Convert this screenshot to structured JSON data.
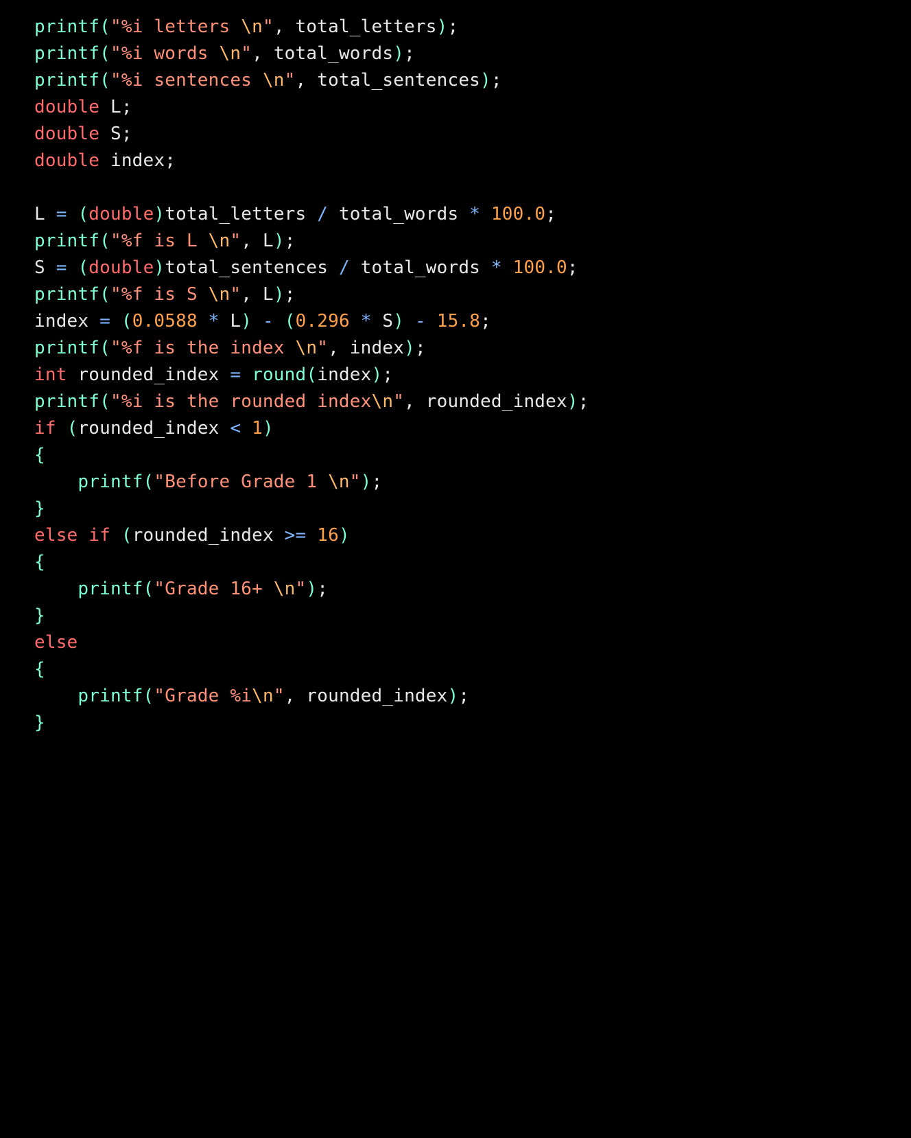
{
  "code": {
    "lines": [
      [
        {
          "cls": "tok-fn",
          "t": "printf"
        },
        {
          "cls": "tok-brace",
          "t": "("
        },
        {
          "cls": "tok-str",
          "t": "\"%i letters "
        },
        {
          "cls": "tok-esc",
          "t": "\\n"
        },
        {
          "cls": "tok-str",
          "t": "\""
        },
        {
          "cls": "tok-punc",
          "t": ", "
        },
        {
          "cls": "tok-var",
          "t": "total_letters"
        },
        {
          "cls": "tok-brace",
          "t": ")"
        },
        {
          "cls": "tok-punc",
          "t": ";"
        }
      ],
      [
        {
          "cls": "tok-fn",
          "t": "printf"
        },
        {
          "cls": "tok-brace",
          "t": "("
        },
        {
          "cls": "tok-str",
          "t": "\"%i words "
        },
        {
          "cls": "tok-esc",
          "t": "\\n"
        },
        {
          "cls": "tok-str",
          "t": "\""
        },
        {
          "cls": "tok-punc",
          "t": ", "
        },
        {
          "cls": "tok-var",
          "t": "total_words"
        },
        {
          "cls": "tok-brace",
          "t": ")"
        },
        {
          "cls": "tok-punc",
          "t": ";"
        }
      ],
      [
        {
          "cls": "tok-fn",
          "t": "printf"
        },
        {
          "cls": "tok-brace",
          "t": "("
        },
        {
          "cls": "tok-str",
          "t": "\"%i sentences "
        },
        {
          "cls": "tok-esc",
          "t": "\\n"
        },
        {
          "cls": "tok-str",
          "t": "\""
        },
        {
          "cls": "tok-punc",
          "t": ", "
        },
        {
          "cls": "tok-var",
          "t": "total_sentences"
        },
        {
          "cls": "tok-brace",
          "t": ")"
        },
        {
          "cls": "tok-punc",
          "t": ";"
        }
      ],
      [
        {
          "cls": "tok-kw",
          "t": "double"
        },
        {
          "cls": "tok-var",
          "t": " L"
        },
        {
          "cls": "tok-punc",
          "t": ";"
        }
      ],
      [
        {
          "cls": "tok-kw",
          "t": "double"
        },
        {
          "cls": "tok-var",
          "t": " S"
        },
        {
          "cls": "tok-punc",
          "t": ";"
        }
      ],
      [
        {
          "cls": "tok-kw",
          "t": "double"
        },
        {
          "cls": "tok-var",
          "t": " index"
        },
        {
          "cls": "tok-punc",
          "t": ";"
        }
      ],
      [
        {
          "cls": "tok-var",
          "t": ""
        }
      ],
      [
        {
          "cls": "tok-var",
          "t": "L "
        },
        {
          "cls": "tok-op",
          "t": "="
        },
        {
          "cls": "tok-var",
          "t": " "
        },
        {
          "cls": "tok-brace",
          "t": "("
        },
        {
          "cls": "tok-kw",
          "t": "double"
        },
        {
          "cls": "tok-brace",
          "t": ")"
        },
        {
          "cls": "tok-var",
          "t": "total_letters "
        },
        {
          "cls": "tok-op",
          "t": "/"
        },
        {
          "cls": "tok-var",
          "t": " total_words "
        },
        {
          "cls": "tok-op",
          "t": "*"
        },
        {
          "cls": "tok-var",
          "t": " "
        },
        {
          "cls": "tok-num",
          "t": "100.0"
        },
        {
          "cls": "tok-punc",
          "t": ";"
        }
      ],
      [
        {
          "cls": "tok-fn",
          "t": "printf"
        },
        {
          "cls": "tok-brace",
          "t": "("
        },
        {
          "cls": "tok-str",
          "t": "\"%f is L "
        },
        {
          "cls": "tok-esc",
          "t": "\\n"
        },
        {
          "cls": "tok-str",
          "t": "\""
        },
        {
          "cls": "tok-punc",
          "t": ", "
        },
        {
          "cls": "tok-var",
          "t": "L"
        },
        {
          "cls": "tok-brace",
          "t": ")"
        },
        {
          "cls": "tok-punc",
          "t": ";"
        }
      ],
      [
        {
          "cls": "tok-var",
          "t": "S "
        },
        {
          "cls": "tok-op",
          "t": "="
        },
        {
          "cls": "tok-var",
          "t": " "
        },
        {
          "cls": "tok-brace",
          "t": "("
        },
        {
          "cls": "tok-kw",
          "t": "double"
        },
        {
          "cls": "tok-brace",
          "t": ")"
        },
        {
          "cls": "tok-var",
          "t": "total_sentences "
        },
        {
          "cls": "tok-op",
          "t": "/"
        },
        {
          "cls": "tok-var",
          "t": " total_words "
        },
        {
          "cls": "tok-op",
          "t": "*"
        },
        {
          "cls": "tok-var",
          "t": " "
        },
        {
          "cls": "tok-num",
          "t": "100.0"
        },
        {
          "cls": "tok-punc",
          "t": ";"
        }
      ],
      [
        {
          "cls": "tok-fn",
          "t": "printf"
        },
        {
          "cls": "tok-brace",
          "t": "("
        },
        {
          "cls": "tok-str",
          "t": "\"%f is S "
        },
        {
          "cls": "tok-esc",
          "t": "\\n"
        },
        {
          "cls": "tok-str",
          "t": "\""
        },
        {
          "cls": "tok-punc",
          "t": ", "
        },
        {
          "cls": "tok-var",
          "t": "L"
        },
        {
          "cls": "tok-brace",
          "t": ")"
        },
        {
          "cls": "tok-punc",
          "t": ";"
        }
      ],
      [
        {
          "cls": "tok-var",
          "t": "index "
        },
        {
          "cls": "tok-op",
          "t": "="
        },
        {
          "cls": "tok-var",
          "t": " "
        },
        {
          "cls": "tok-brace",
          "t": "("
        },
        {
          "cls": "tok-num",
          "t": "0.0588"
        },
        {
          "cls": "tok-var",
          "t": " "
        },
        {
          "cls": "tok-op",
          "t": "*"
        },
        {
          "cls": "tok-var",
          "t": " L"
        },
        {
          "cls": "tok-brace",
          "t": ")"
        },
        {
          "cls": "tok-var",
          "t": " "
        },
        {
          "cls": "tok-op",
          "t": "-"
        },
        {
          "cls": "tok-var",
          "t": " "
        },
        {
          "cls": "tok-brace",
          "t": "("
        },
        {
          "cls": "tok-num",
          "t": "0.296"
        },
        {
          "cls": "tok-var",
          "t": " "
        },
        {
          "cls": "tok-op",
          "t": "*"
        },
        {
          "cls": "tok-var",
          "t": " S"
        },
        {
          "cls": "tok-brace",
          "t": ")"
        },
        {
          "cls": "tok-var",
          "t": " "
        },
        {
          "cls": "tok-op",
          "t": "-"
        },
        {
          "cls": "tok-var",
          "t": " "
        },
        {
          "cls": "tok-num",
          "t": "15.8"
        },
        {
          "cls": "tok-punc",
          "t": ";"
        }
      ],
      [
        {
          "cls": "tok-fn",
          "t": "printf"
        },
        {
          "cls": "tok-brace",
          "t": "("
        },
        {
          "cls": "tok-str",
          "t": "\"%f is the index "
        },
        {
          "cls": "tok-esc",
          "t": "\\n"
        },
        {
          "cls": "tok-str",
          "t": "\""
        },
        {
          "cls": "tok-punc",
          "t": ", "
        },
        {
          "cls": "tok-var",
          "t": "index"
        },
        {
          "cls": "tok-brace",
          "t": ")"
        },
        {
          "cls": "tok-punc",
          "t": ";"
        }
      ],
      [
        {
          "cls": "tok-kw",
          "t": "int"
        },
        {
          "cls": "tok-var",
          "t": " rounded_index "
        },
        {
          "cls": "tok-op",
          "t": "="
        },
        {
          "cls": "tok-var",
          "t": " "
        },
        {
          "cls": "tok-fn",
          "t": "round"
        },
        {
          "cls": "tok-brace",
          "t": "("
        },
        {
          "cls": "tok-var",
          "t": "index"
        },
        {
          "cls": "tok-brace",
          "t": ")"
        },
        {
          "cls": "tok-punc",
          "t": ";"
        }
      ],
      [
        {
          "cls": "tok-fn",
          "t": "printf"
        },
        {
          "cls": "tok-brace",
          "t": "("
        },
        {
          "cls": "tok-str",
          "t": "\"%i is the rounded index"
        },
        {
          "cls": "tok-esc",
          "t": "\\n"
        },
        {
          "cls": "tok-str",
          "t": "\""
        },
        {
          "cls": "tok-punc",
          "t": ", "
        },
        {
          "cls": "tok-var",
          "t": "rounded_index"
        },
        {
          "cls": "tok-brace",
          "t": ")"
        },
        {
          "cls": "tok-punc",
          "t": ";"
        }
      ],
      [
        {
          "cls": "tok-kw",
          "t": "if"
        },
        {
          "cls": "tok-var",
          "t": " "
        },
        {
          "cls": "tok-brace",
          "t": "("
        },
        {
          "cls": "tok-var",
          "t": "rounded_index "
        },
        {
          "cls": "tok-op",
          "t": "<"
        },
        {
          "cls": "tok-var",
          "t": " "
        },
        {
          "cls": "tok-num",
          "t": "1"
        },
        {
          "cls": "tok-brace",
          "t": ")"
        }
      ],
      [
        {
          "cls": "tok-brace",
          "t": "{"
        }
      ],
      [
        {
          "cls": "tok-var",
          "t": "    "
        },
        {
          "cls": "tok-fn",
          "t": "printf"
        },
        {
          "cls": "tok-brace",
          "t": "("
        },
        {
          "cls": "tok-str",
          "t": "\"Before Grade 1 "
        },
        {
          "cls": "tok-esc",
          "t": "\\n"
        },
        {
          "cls": "tok-str",
          "t": "\""
        },
        {
          "cls": "tok-brace",
          "t": ")"
        },
        {
          "cls": "tok-punc",
          "t": ";"
        }
      ],
      [
        {
          "cls": "tok-brace",
          "t": "}"
        }
      ],
      [
        {
          "cls": "tok-kw",
          "t": "else if"
        },
        {
          "cls": "tok-var",
          "t": " "
        },
        {
          "cls": "tok-brace",
          "t": "("
        },
        {
          "cls": "tok-var",
          "t": "rounded_index "
        },
        {
          "cls": "tok-op",
          "t": ">="
        },
        {
          "cls": "tok-var",
          "t": " "
        },
        {
          "cls": "tok-num",
          "t": "16"
        },
        {
          "cls": "tok-brace",
          "t": ")"
        }
      ],
      [
        {
          "cls": "tok-brace",
          "t": "{"
        }
      ],
      [
        {
          "cls": "tok-var",
          "t": "    "
        },
        {
          "cls": "tok-fn",
          "t": "printf"
        },
        {
          "cls": "tok-brace",
          "t": "("
        },
        {
          "cls": "tok-str",
          "t": "\"Grade 16+ "
        },
        {
          "cls": "tok-esc",
          "t": "\\n"
        },
        {
          "cls": "tok-str",
          "t": "\""
        },
        {
          "cls": "tok-brace",
          "t": ")"
        },
        {
          "cls": "tok-punc",
          "t": ";"
        }
      ],
      [
        {
          "cls": "tok-brace",
          "t": "}"
        }
      ],
      [
        {
          "cls": "tok-kw",
          "t": "else"
        }
      ],
      [
        {
          "cls": "tok-brace",
          "t": "{"
        }
      ],
      [
        {
          "cls": "tok-var",
          "t": "    "
        },
        {
          "cls": "tok-fn",
          "t": "printf"
        },
        {
          "cls": "tok-brace",
          "t": "("
        },
        {
          "cls": "tok-str",
          "t": "\"Grade %i"
        },
        {
          "cls": "tok-esc",
          "t": "\\n"
        },
        {
          "cls": "tok-str",
          "t": "\""
        },
        {
          "cls": "tok-punc",
          "t": ", "
        },
        {
          "cls": "tok-var",
          "t": "rounded_index"
        },
        {
          "cls": "tok-brace",
          "t": ")"
        },
        {
          "cls": "tok-punc",
          "t": ";"
        }
      ],
      [
        {
          "cls": "tok-brace",
          "t": "}"
        }
      ]
    ]
  }
}
